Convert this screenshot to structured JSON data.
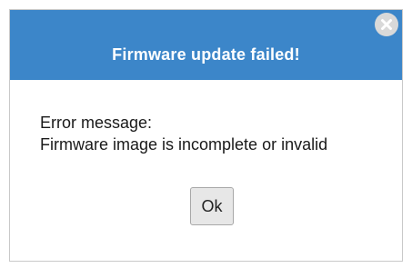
{
  "dialog": {
    "title": "Firmware update failed!",
    "close_icon": "close-icon",
    "error_label": "Error message:",
    "error_text": "Firmware image is incomplete or invalid",
    "ok_label": "Ok"
  },
  "colors": {
    "title_bar": "#3c86c9",
    "title_text": "#ffffff",
    "close_button": "#d9d9d9",
    "ok_button": "#e7e7e7"
  }
}
